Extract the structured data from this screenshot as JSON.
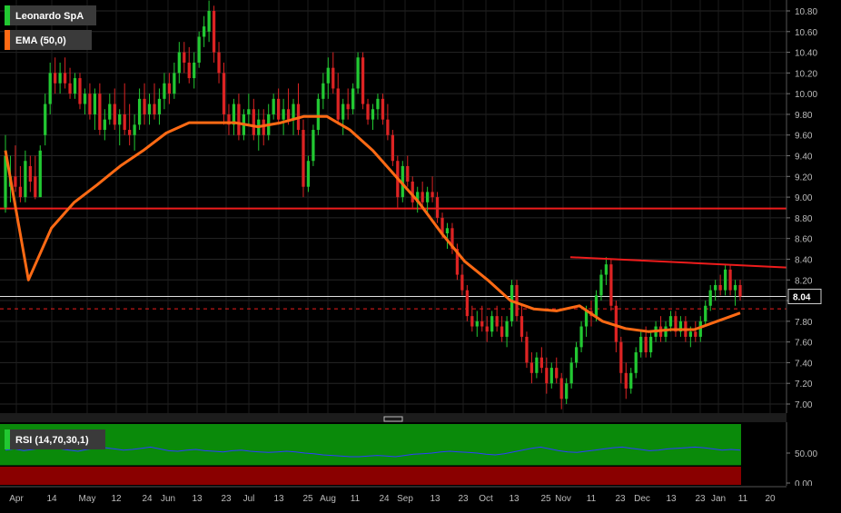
{
  "chart_data": {
    "type": "candlestick",
    "instrument": "Leonardo SpA",
    "indicator_label": "EMA (50,0)",
    "rsi_label": "RSI (14,70,30,1)",
    "last_price_label": "8.04",
    "last_price": 8.04,
    "y_ticks": [
      "10.80",
      "10.60",
      "10.40",
      "10.20",
      "10.00",
      "9.80",
      "9.60",
      "9.40",
      "9.20",
      "9.00",
      "8.80",
      "8.60",
      "8.40",
      "8.20",
      "8.00",
      "7.80",
      "7.60",
      "7.40",
      "7.20",
      "7.00"
    ],
    "ylim": [
      6.92,
      10.9
    ],
    "rsi_ticks": [
      "50.00",
      "0.00"
    ],
    "rsi_ylim": [
      0,
      100
    ],
    "x_labels": [
      "Apr",
      "14",
      "May",
      "12",
      "24",
      "Jun",
      "13",
      "23",
      "Jul",
      "13",
      "25",
      "Aug",
      "11",
      "24",
      "Sep",
      "13",
      "23",
      "Oct",
      "13",
      "25",
      "Nov",
      "11",
      "23",
      "Dec",
      "13",
      "23",
      "Jan",
      "11",
      "20"
    ],
    "horizontal_level": 8.89,
    "dashed_level": 7.92,
    "trendline": {
      "start": [
        "25 Nov",
        8.42
      ],
      "end": [
        "20",
        8.32
      ]
    },
    "ema_points": [
      9.45,
      8.2,
      8.7,
      8.95,
      9.12,
      9.3,
      9.45,
      9.62,
      9.72,
      9.72,
      9.72,
      9.68,
      9.72,
      9.78,
      9.78,
      9.65,
      9.45,
      9.2,
      8.95,
      8.65,
      8.38,
      8.2,
      8.0,
      7.92,
      7.9,
      7.95,
      7.8,
      7.73,
      7.7,
      7.72,
      7.72,
      7.8,
      7.88
    ],
    "candles": [
      {
        "o": 8.9,
        "h": 9.6,
        "l": 8.85,
        "c": 9.4
      },
      {
        "o": 9.1,
        "h": 9.4,
        "l": 8.95,
        "c": 9.2
      },
      {
        "o": 9.2,
        "h": 9.5,
        "l": 9.05,
        "c": 9.1
      },
      {
        "o": 9.1,
        "h": 9.3,
        "l": 8.95,
        "c": 9.0
      },
      {
        "o": 9.0,
        "h": 9.45,
        "l": 8.95,
        "c": 9.35
      },
      {
        "o": 9.3,
        "h": 9.4,
        "l": 9.05,
        "c": 9.15
      },
      {
        "o": 9.2,
        "h": 9.4,
        "l": 8.98,
        "c": 9.0
      },
      {
        "o": 9.0,
        "h": 9.5,
        "l": 9.0,
        "c": 9.45
      },
      {
        "o": 9.6,
        "h": 10.0,
        "l": 9.5,
        "c": 9.9
      },
      {
        "o": 9.9,
        "h": 10.3,
        "l": 9.8,
        "c": 10.2
      },
      {
        "o": 10.2,
        "h": 10.35,
        "l": 10.0,
        "c": 10.1
      },
      {
        "o": 10.1,
        "h": 10.3,
        "l": 10.0,
        "c": 10.2
      },
      {
        "o": 10.2,
        "h": 10.35,
        "l": 10.05,
        "c": 10.1
      },
      {
        "o": 10.1,
        "h": 10.25,
        "l": 9.95,
        "c": 10.0
      },
      {
        "o": 10.0,
        "h": 10.2,
        "l": 9.95,
        "c": 10.15
      },
      {
        "o": 10.15,
        "h": 10.2,
        "l": 9.85,
        "c": 9.9
      },
      {
        "o": 9.9,
        "h": 10.05,
        "l": 9.8,
        "c": 10.0
      },
      {
        "o": 10.0,
        "h": 10.1,
        "l": 9.75,
        "c": 9.8
      },
      {
        "o": 9.8,
        "h": 10.05,
        "l": 9.65,
        "c": 10.0
      },
      {
        "o": 10.0,
        "h": 10.1,
        "l": 9.6,
        "c": 9.65
      },
      {
        "o": 9.65,
        "h": 9.85,
        "l": 9.55,
        "c": 9.75
      },
      {
        "o": 9.75,
        "h": 10.0,
        "l": 9.7,
        "c": 9.9
      },
      {
        "o": 9.9,
        "h": 10.05,
        "l": 9.65,
        "c": 9.7
      },
      {
        "o": 9.7,
        "h": 9.85,
        "l": 9.5,
        "c": 9.8
      },
      {
        "o": 9.8,
        "h": 10.1,
        "l": 9.6,
        "c": 9.65
      },
      {
        "o": 9.65,
        "h": 9.9,
        "l": 9.5,
        "c": 9.6
      },
      {
        "o": 9.6,
        "h": 9.8,
        "l": 9.45,
        "c": 9.7
      },
      {
        "o": 9.7,
        "h": 10.05,
        "l": 9.65,
        "c": 9.95
      },
      {
        "o": 9.95,
        "h": 10.1,
        "l": 9.7,
        "c": 9.8
      },
      {
        "o": 9.8,
        "h": 10.0,
        "l": 9.7,
        "c": 9.9
      },
      {
        "o": 9.9,
        "h": 10.1,
        "l": 9.75,
        "c": 9.8
      },
      {
        "o": 9.8,
        "h": 10.05,
        "l": 9.7,
        "c": 9.95
      },
      {
        "o": 9.95,
        "h": 10.2,
        "l": 9.85,
        "c": 10.1
      },
      {
        "o": 10.1,
        "h": 10.2,
        "l": 9.9,
        "c": 10.0
      },
      {
        "o": 10.0,
        "h": 10.3,
        "l": 9.95,
        "c": 10.2
      },
      {
        "o": 10.2,
        "h": 10.5,
        "l": 10.1,
        "c": 10.4
      },
      {
        "o": 10.4,
        "h": 10.5,
        "l": 10.2,
        "c": 10.3
      },
      {
        "o": 10.3,
        "h": 10.45,
        "l": 10.1,
        "c": 10.15
      },
      {
        "o": 10.15,
        "h": 10.4,
        "l": 10.05,
        "c": 10.3
      },
      {
        "o": 10.3,
        "h": 10.6,
        "l": 10.25,
        "c": 10.55
      },
      {
        "o": 10.55,
        "h": 10.75,
        "l": 10.45,
        "c": 10.65
      },
      {
        "o": 10.6,
        "h": 10.9,
        "l": 10.5,
        "c": 10.8
      },
      {
        "o": 10.8,
        "h": 10.85,
        "l": 10.3,
        "c": 10.4
      },
      {
        "o": 10.4,
        "h": 10.5,
        "l": 10.1,
        "c": 10.2
      },
      {
        "o": 10.2,
        "h": 10.3,
        "l": 9.7,
        "c": 9.8
      },
      {
        "o": 9.8,
        "h": 9.9,
        "l": 9.6,
        "c": 9.7
      },
      {
        "o": 9.7,
        "h": 9.95,
        "l": 9.6,
        "c": 9.9
      },
      {
        "o": 9.9,
        "h": 10.0,
        "l": 9.55,
        "c": 9.6
      },
      {
        "o": 9.6,
        "h": 9.85,
        "l": 9.55,
        "c": 9.8
      },
      {
        "o": 9.8,
        "h": 10.0,
        "l": 9.7,
        "c": 9.85
      },
      {
        "o": 9.85,
        "h": 9.95,
        "l": 9.55,
        "c": 9.6
      },
      {
        "o": 9.6,
        "h": 9.85,
        "l": 9.45,
        "c": 9.75
      },
      {
        "o": 9.75,
        "h": 9.85,
        "l": 9.5,
        "c": 9.6
      },
      {
        "o": 9.6,
        "h": 9.9,
        "l": 9.55,
        "c": 9.8
      },
      {
        "o": 9.8,
        "h": 10.0,
        "l": 9.75,
        "c": 9.95
      },
      {
        "o": 9.95,
        "h": 10.05,
        "l": 9.7,
        "c": 9.75
      },
      {
        "o": 9.75,
        "h": 9.95,
        "l": 9.6,
        "c": 9.85
      },
      {
        "o": 9.85,
        "h": 10.05,
        "l": 9.7,
        "c": 9.75
      },
      {
        "o": 9.75,
        "h": 9.95,
        "l": 9.6,
        "c": 9.9
      },
      {
        "o": 9.9,
        "h": 10.1,
        "l": 9.6,
        "c": 9.65
      },
      {
        "o": 9.65,
        "h": 9.75,
        "l": 9.0,
        "c": 9.1
      },
      {
        "o": 9.1,
        "h": 9.4,
        "l": 9.05,
        "c": 9.35
      },
      {
        "o": 9.35,
        "h": 9.7,
        "l": 9.3,
        "c": 9.65
      },
      {
        "o": 9.65,
        "h": 10.0,
        "l": 9.6,
        "c": 9.95
      },
      {
        "o": 9.95,
        "h": 10.2,
        "l": 9.85,
        "c": 10.1
      },
      {
        "o": 10.1,
        "h": 10.35,
        "l": 9.95,
        "c": 10.25
      },
      {
        "o": 10.25,
        "h": 10.4,
        "l": 10.0,
        "c": 10.05
      },
      {
        "o": 10.05,
        "h": 10.2,
        "l": 9.7,
        "c": 9.75
      },
      {
        "o": 9.75,
        "h": 9.95,
        "l": 9.6,
        "c": 9.9
      },
      {
        "o": 9.9,
        "h": 10.05,
        "l": 9.75,
        "c": 9.85
      },
      {
        "o": 9.85,
        "h": 10.1,
        "l": 9.8,
        "c": 10.05
      },
      {
        "o": 10.05,
        "h": 10.4,
        "l": 10.0,
        "c": 10.35
      },
      {
        "o": 10.35,
        "h": 10.4,
        "l": 9.85,
        "c": 9.9
      },
      {
        "o": 9.9,
        "h": 9.95,
        "l": 9.7,
        "c": 9.75
      },
      {
        "o": 9.75,
        "h": 9.9,
        "l": 9.65,
        "c": 9.85
      },
      {
        "o": 9.85,
        "h": 10.0,
        "l": 9.75,
        "c": 9.95
      },
      {
        "o": 9.95,
        "h": 10.0,
        "l": 9.7,
        "c": 9.75
      },
      {
        "o": 9.75,
        "h": 9.9,
        "l": 9.55,
        "c": 9.6
      },
      {
        "o": 9.6,
        "h": 9.65,
        "l": 9.3,
        "c": 9.35
      },
      {
        "o": 9.35,
        "h": 9.4,
        "l": 8.9,
        "c": 9.0
      },
      {
        "o": 9.0,
        "h": 9.35,
        "l": 8.95,
        "c": 9.3
      },
      {
        "o": 9.3,
        "h": 9.4,
        "l": 9.1,
        "c": 9.15
      },
      {
        "o": 9.15,
        "h": 9.2,
        "l": 8.9,
        "c": 8.95
      },
      {
        "o": 8.95,
        "h": 9.1,
        "l": 8.85,
        "c": 9.05
      },
      {
        "o": 9.05,
        "h": 9.15,
        "l": 8.9,
        "c": 8.95
      },
      {
        "o": 8.95,
        "h": 9.1,
        "l": 8.85,
        "c": 9.05
      },
      {
        "o": 9.05,
        "h": 9.2,
        "l": 8.95,
        "c": 9.0
      },
      {
        "o": 9.0,
        "h": 9.05,
        "l": 8.75,
        "c": 8.8
      },
      {
        "o": 8.8,
        "h": 8.85,
        "l": 8.6,
        "c": 8.65
      },
      {
        "o": 8.65,
        "h": 8.75,
        "l": 8.5,
        "c": 8.7
      },
      {
        "o": 8.7,
        "h": 8.75,
        "l": 8.45,
        "c": 8.5
      },
      {
        "o": 8.5,
        "h": 8.55,
        "l": 8.2,
        "c": 8.25
      },
      {
        "o": 8.25,
        "h": 8.35,
        "l": 8.05,
        "c": 8.1
      },
      {
        "o": 8.1,
        "h": 8.15,
        "l": 7.8,
        "c": 7.85
      },
      {
        "o": 7.85,
        "h": 7.95,
        "l": 7.7,
        "c": 7.75
      },
      {
        "o": 7.75,
        "h": 7.9,
        "l": 7.65,
        "c": 7.8
      },
      {
        "o": 7.8,
        "h": 7.95,
        "l": 7.7,
        "c": 7.75
      },
      {
        "o": 7.75,
        "h": 7.85,
        "l": 7.6,
        "c": 7.7
      },
      {
        "o": 7.7,
        "h": 7.9,
        "l": 7.65,
        "c": 7.85
      },
      {
        "o": 7.85,
        "h": 7.95,
        "l": 7.7,
        "c": 7.75
      },
      {
        "o": 7.75,
        "h": 7.85,
        "l": 7.6,
        "c": 7.65
      },
      {
        "o": 7.65,
        "h": 7.85,
        "l": 7.55,
        "c": 7.8
      },
      {
        "o": 7.8,
        "h": 8.2,
        "l": 7.75,
        "c": 8.15
      },
      {
        "o": 8.15,
        "h": 8.2,
        "l": 7.8,
        "c": 7.85
      },
      {
        "o": 7.85,
        "h": 7.95,
        "l": 7.6,
        "c": 7.65
      },
      {
        "o": 7.65,
        "h": 7.7,
        "l": 7.35,
        "c": 7.4
      },
      {
        "o": 7.4,
        "h": 7.5,
        "l": 7.2,
        "c": 7.3
      },
      {
        "o": 7.3,
        "h": 7.5,
        "l": 7.25,
        "c": 7.45
      },
      {
        "o": 7.45,
        "h": 7.55,
        "l": 7.3,
        "c": 7.35
      },
      {
        "o": 7.35,
        "h": 7.45,
        "l": 7.1,
        "c": 7.2
      },
      {
        "o": 7.2,
        "h": 7.4,
        "l": 7.15,
        "c": 7.35
      },
      {
        "o": 7.35,
        "h": 7.45,
        "l": 7.2,
        "c": 7.25
      },
      {
        "o": 7.25,
        "h": 7.3,
        "l": 6.95,
        "c": 7.05
      },
      {
        "o": 7.05,
        "h": 7.25,
        "l": 7.0,
        "c": 7.2
      },
      {
        "o": 7.2,
        "h": 7.45,
        "l": 7.15,
        "c": 7.4
      },
      {
        "o": 7.4,
        "h": 7.6,
        "l": 7.35,
        "c": 7.55
      },
      {
        "o": 7.55,
        "h": 7.8,
        "l": 7.5,
        "c": 7.75
      },
      {
        "o": 7.75,
        "h": 7.95,
        "l": 7.65,
        "c": 7.9
      },
      {
        "o": 7.9,
        "h": 8.0,
        "l": 7.75,
        "c": 7.85
      },
      {
        "o": 7.85,
        "h": 8.1,
        "l": 7.8,
        "c": 8.05
      },
      {
        "o": 8.05,
        "h": 8.3,
        "l": 8.0,
        "c": 8.25
      },
      {
        "o": 8.25,
        "h": 8.42,
        "l": 8.15,
        "c": 8.35
      },
      {
        "o": 8.35,
        "h": 8.4,
        "l": 7.9,
        "c": 7.95
      },
      {
        "o": 7.95,
        "h": 8.0,
        "l": 7.5,
        "c": 7.6
      },
      {
        "o": 7.6,
        "h": 7.65,
        "l": 7.2,
        "c": 7.3
      },
      {
        "o": 7.3,
        "h": 7.4,
        "l": 7.05,
        "c": 7.15
      },
      {
        "o": 7.15,
        "h": 7.35,
        "l": 7.1,
        "c": 7.3
      },
      {
        "o": 7.3,
        "h": 7.55,
        "l": 7.25,
        "c": 7.5
      },
      {
        "o": 7.5,
        "h": 7.7,
        "l": 7.45,
        "c": 7.65
      },
      {
        "o": 7.65,
        "h": 7.75,
        "l": 7.45,
        "c": 7.5
      },
      {
        "o": 7.5,
        "h": 7.7,
        "l": 7.45,
        "c": 7.65
      },
      {
        "o": 7.65,
        "h": 7.8,
        "l": 7.6,
        "c": 7.75
      },
      {
        "o": 7.75,
        "h": 7.85,
        "l": 7.6,
        "c": 7.65
      },
      {
        "o": 7.65,
        "h": 7.8,
        "l": 7.6,
        "c": 7.75
      },
      {
        "o": 7.75,
        "h": 7.9,
        "l": 7.7,
        "c": 7.85
      },
      {
        "o": 7.85,
        "h": 7.9,
        "l": 7.65,
        "c": 7.7
      },
      {
        "o": 7.7,
        "h": 7.85,
        "l": 7.65,
        "c": 7.8
      },
      {
        "o": 7.8,
        "h": 7.85,
        "l": 7.6,
        "c": 7.65
      },
      {
        "o": 7.65,
        "h": 7.75,
        "l": 7.55,
        "c": 7.7
      },
      {
        "o": 7.7,
        "h": 7.8,
        "l": 7.6,
        "c": 7.65
      },
      {
        "o": 7.65,
        "h": 7.85,
        "l": 7.6,
        "c": 7.8
      },
      {
        "o": 7.8,
        "h": 8.0,
        "l": 7.75,
        "c": 7.95
      },
      {
        "o": 7.95,
        "h": 8.15,
        "l": 7.9,
        "c": 8.1
      },
      {
        "o": 8.1,
        "h": 8.2,
        "l": 8.0,
        "c": 8.15
      },
      {
        "o": 8.15,
        "h": 8.25,
        "l": 8.05,
        "c": 8.1
      },
      {
        "o": 8.1,
        "h": 8.35,
        "l": 8.05,
        "c": 8.3
      },
      {
        "o": 8.3,
        "h": 8.35,
        "l": 8.05,
        "c": 8.1
      },
      {
        "o": 8.1,
        "h": 8.2,
        "l": 7.95,
        "c": 8.15
      },
      {
        "o": 8.15,
        "h": 8.2,
        "l": 8.0,
        "c": 8.04
      }
    ],
    "rsi_values": [
      55,
      57,
      54,
      56,
      58,
      60,
      57,
      55,
      53,
      56,
      58,
      59,
      57,
      55,
      56,
      58,
      60,
      57,
      54,
      53,
      55,
      56,
      54,
      53,
      52,
      54,
      55,
      53,
      52,
      51,
      52,
      53,
      52,
      50,
      49,
      47,
      46,
      45,
      44,
      44,
      45,
      46,
      45,
      44,
      46,
      48,
      49,
      50,
      52,
      53,
      52,
      51,
      50,
      48,
      47,
      49,
      52,
      55,
      58,
      60,
      57,
      54,
      52,
      51,
      53,
      55,
      57,
      59,
      60,
      58,
      56,
      54,
      55,
      57,
      58,
      59,
      60,
      59,
      57,
      55,
      56,
      55
    ],
    "colors": {
      "up": "#22c832",
      "down": "#dc2323",
      "ema": "#ff6a14",
      "lines": "#ee1c1c",
      "rsi_line": "#2e3cff",
      "overbought": "#0a8a0a",
      "oversold": "#8a0000"
    }
  }
}
